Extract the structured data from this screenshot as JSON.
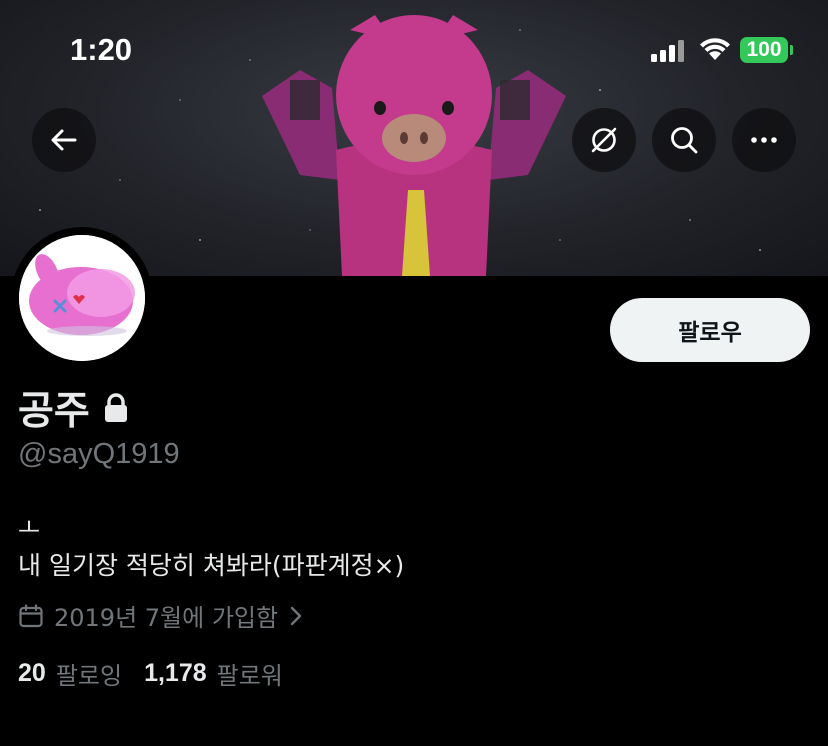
{
  "status_bar": {
    "time": "1:20",
    "battery": "100"
  },
  "header": {
    "back_icon": "arrow-left-icon",
    "actions": [
      "grok-icon",
      "search-icon",
      "more-icon"
    ]
  },
  "profile": {
    "follow_button": "팔로우",
    "name": "공주",
    "handle": "@sayQ1919",
    "bio_line1": "ㅗ",
    "bio_line2": "내 일기장 적당히 쳐봐라(파판계정×)",
    "joined": "2019년 7월에 가입함",
    "following_count": "20",
    "following_label": "팔로잉",
    "followers_count": "1,178",
    "followers_label": "팔로워"
  },
  "colors": {
    "accent_battery": "#34c759",
    "muted_text": "#71767b",
    "button_bg": "#eff3f4"
  }
}
